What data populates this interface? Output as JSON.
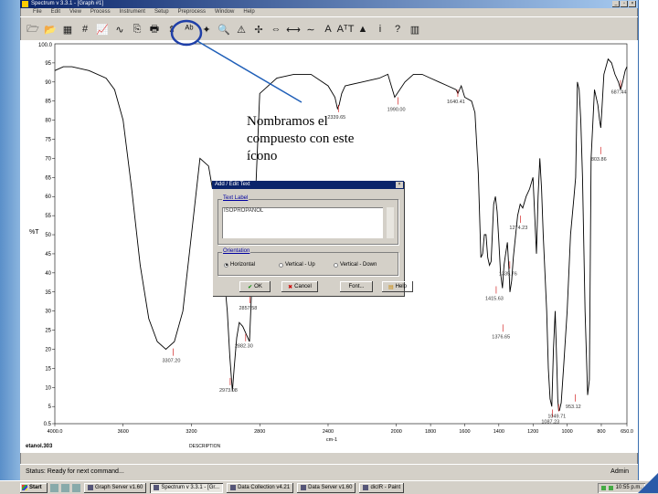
{
  "window": {
    "title": "Spectrum v 3.3.1 - [Graph #1]",
    "controls": [
      "_",
      "▫",
      "×"
    ]
  },
  "menu": [
    "File",
    "Edit",
    "View",
    "Process",
    "Instrument",
    "Setup",
    "Preprocess",
    "Window",
    "Help"
  ],
  "toolbar": {
    "icons": [
      "open-icon",
      "folder-icon",
      "grid-icon",
      "hash-icon",
      "chart-icon",
      "spectrum-icon",
      "copy-icon",
      "print-icon",
      "scale-icon",
      "text-label-icon",
      "peak-icon",
      "zoom-icon",
      "triangle-icon",
      "arrows-icon",
      "pan-icon",
      "measure-icon",
      "baseline-icon",
      "font-a-icon",
      "abc-icon",
      "arrow-up-icon",
      "info-icon",
      "help-icon",
      "library-icon"
    ],
    "glyphs": [
      "🗁",
      "📂",
      "▦",
      "#",
      "📈",
      "∿",
      "⎘",
      "🖶",
      "⇕",
      "ᴬᵇ",
      "✦",
      "🔍",
      "⚠",
      "✢",
      "⇔",
      "⟷",
      "∼",
      "A",
      "AᵀT",
      "▲",
      "i",
      "?",
      "▥"
    ],
    "highlight_color": "#1f3fa8"
  },
  "chart_data": {
    "type": "line",
    "ylabel": "%T",
    "xlabel": "cm-1",
    "y_top_label": "100.0",
    "y_ticks": [
      "95",
      "90",
      "85",
      "80",
      "75",
      "70",
      "65",
      "60",
      "55",
      "50",
      "45",
      "40",
      "35",
      "30",
      "25",
      "20",
      "15",
      "10",
      "5",
      "0.5"
    ],
    "x_ticks": [
      "4000.0",
      "3600",
      "3200",
      "2800",
      "2400",
      "2000",
      "1800",
      "1600",
      "1400",
      "1200",
      "1000",
      "800",
      "650.0"
    ],
    "xlim": [
      4000,
      650
    ],
    "ylim": [
      0.5,
      100
    ],
    "line_color": "#000000",
    "label_color": "#cc0000",
    "x": [
      4000,
      3950,
      3900,
      3800,
      3700,
      3650,
      3600,
      3550,
      3500,
      3450,
      3400,
      3350,
      3300,
      3250,
      3200,
      3150,
      3100,
      3050,
      3010,
      2990,
      2975,
      2960,
      2950,
      2935,
      2920,
      2900,
      2880,
      2860,
      2800,
      2700,
      2600,
      2500,
      2400,
      2360,
      2345,
      2335,
      2320,
      2300,
      2200,
      2100,
      2050,
      2010,
      1950,
      1900,
      1850,
      1800,
      1750,
      1700,
      1650,
      1640,
      1620,
      1600,
      1560,
      1540,
      1520,
      1505,
      1495,
      1485,
      1475,
      1465,
      1455,
      1445,
      1430,
      1420,
      1410,
      1400,
      1390,
      1379,
      1370,
      1360,
      1350,
      1340,
      1335,
      1325,
      1315,
      1290,
      1275,
      1260,
      1240,
      1220,
      1200,
      1190,
      1180,
      1170,
      1160,
      1150,
      1140,
      1130,
      1120,
      1110,
      1100,
      1090,
      1080,
      1070,
      1060,
      1055,
      1050,
      1045,
      1035,
      1020,
      1000,
      980,
      960,
      950,
      940,
      930,
      920,
      910,
      895,
      880,
      870,
      860,
      840,
      820,
      810,
      803,
      795,
      785,
      760,
      740,
      720,
      700,
      687,
      675,
      660,
      650
    ],
    "y": [
      93,
      94,
      94,
      93,
      91,
      88,
      80,
      62,
      42,
      28,
      22,
      20,
      22,
      30,
      50,
      70,
      68,
      55,
      40,
      30,
      18,
      9,
      15,
      23,
      27,
      26,
      24,
      22,
      87,
      91,
      92,
      92,
      89,
      86,
      83,
      84,
      87,
      89,
      90,
      91,
      92,
      86,
      90,
      92,
      92,
      91,
      90,
      89,
      88,
      87,
      89,
      86,
      85,
      82,
      66,
      44,
      45,
      50,
      50,
      44,
      42,
      43,
      58,
      60,
      56,
      48,
      40,
      36,
      42,
      45,
      48,
      40,
      35,
      38,
      44,
      55,
      58,
      57,
      60,
      62,
      65,
      55,
      45,
      60,
      70,
      62,
      50,
      40,
      30,
      15,
      7,
      5,
      20,
      30,
      15,
      7,
      4,
      4,
      6,
      16,
      30,
      50,
      60,
      65,
      90,
      88,
      80,
      65,
      30,
      8,
      12,
      70,
      88,
      84,
      80,
      78,
      84,
      92,
      96,
      95,
      92,
      90,
      88,
      90,
      93,
      94
    ],
    "peak_labels": [
      {
        "x": 3307.2,
        "y": 20.2,
        "text": "3307.20"
      },
      {
        "x": 2973.0,
        "y": 12.5,
        "text": "2973.08"
      },
      {
        "x": 2882.5,
        "y": 24.0,
        "text": "2882.30"
      },
      {
        "x": 2857.8,
        "y": 34.0,
        "text": "2857.58"
      },
      {
        "x": 2339.6,
        "y": 84.0,
        "text": "2339.65"
      },
      {
        "x": 1990.0,
        "y": 86.0,
        "text": "1990.00"
      },
      {
        "x": 1640.4,
        "y": 88.0,
        "text": "1640.41"
      },
      {
        "x": 1274.2,
        "y": 55.0,
        "text": "1274.23"
      },
      {
        "x": 1335.8,
        "y": 43.0,
        "text": "1335.76"
      },
      {
        "x": 1415.6,
        "y": 36.5,
        "text": "1415.63"
      },
      {
        "x": 1376.6,
        "y": 26.5,
        "text": "1376.65"
      },
      {
        "x": 1087.2,
        "y": 4.2,
        "text": "1087.23"
      },
      {
        "x": 1049.7,
        "y": 5.6,
        "text": "1049.71"
      },
      {
        "x": 953.2,
        "y": 8.2,
        "text": "953.12"
      },
      {
        "x": 803.9,
        "y": 73.0,
        "text": "803.86"
      },
      {
        "x": 687.4,
        "y": 90.5,
        "text": "687.44"
      }
    ]
  },
  "graph_footer": {
    "sample_label": "etanol.303",
    "descr": "DESCRIPTION"
  },
  "dialog": {
    "title": "Add / Edit Text",
    "close": "×",
    "text_label_group": "Text Label",
    "text_value": "ISOPROPANOL",
    "orientation_group": "Orientation",
    "options": [
      "Horizontal",
      "Vertical - Up",
      "Vertical - Down"
    ],
    "selected": 0,
    "buttons": {
      "ok": "OK",
      "cancel": "Cancel",
      "font": "Font...",
      "help": "Help"
    }
  },
  "annotation": {
    "text": "Nombramos el compuesto con este ícono",
    "arrow_color": "#1f5fb8"
  },
  "status": {
    "text": "Status: Ready for next command...",
    "user": "Admin"
  },
  "taskbar": {
    "start": "Start",
    "tasks": [
      "Graph Server v1.60",
      "Spectrum v 3.3.1 - [Gr...",
      "Data Collection v4.21",
      "Data Server v1.60",
      "dicIR - Paint"
    ],
    "active": 1,
    "clock": "10:55 p.m."
  }
}
